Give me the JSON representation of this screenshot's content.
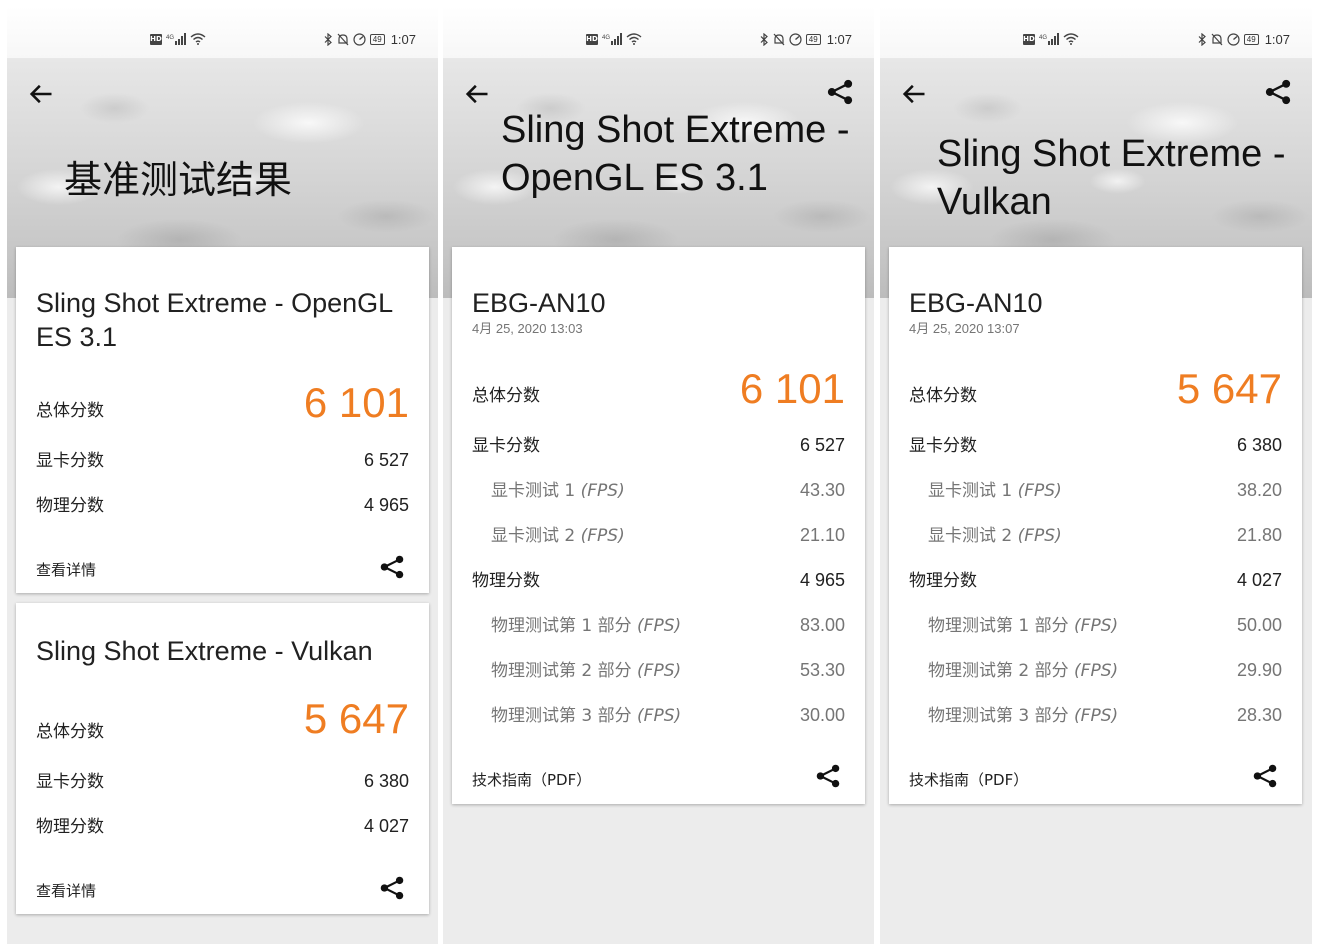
{
  "status_bar": {
    "hd": "HD",
    "network": "4G",
    "battery": "49",
    "time": "1:07"
  },
  "screens": [
    {
      "title": "基准测试结果",
      "cards": [
        {
          "title": "Sling Shot Extreme - OpenGL ES 3.1",
          "overall_label": "总体分数",
          "overall_value": "6 101",
          "graphics_label": "显卡分数",
          "graphics_value": "6 527",
          "physics_label": "物理分数",
          "physics_value": "4 965",
          "details_link": "查看详情"
        },
        {
          "title": "Sling Shot Extreme - Vulkan",
          "overall_label": "总体分数",
          "overall_value": "5 647",
          "graphics_label": "显卡分数",
          "graphics_value": "6 380",
          "physics_label": "物理分数",
          "physics_value": "4 027",
          "details_link": "查看详情"
        }
      ]
    },
    {
      "title": "Sling Shot Extreme - OpenGL ES 3.1",
      "card": {
        "device": "EBG-AN10",
        "date": "4月 25, 2020 13:03",
        "overall_label": "总体分数",
        "overall_value": "6 101",
        "graphics_label": "显卡分数",
        "graphics_value": "6 527",
        "gt1_label": "显卡测试 1",
        "gt2_label": "显卡测试 2",
        "fps_unit": "(FPS)",
        "gt1_value": "43.30",
        "gt2_value": "21.10",
        "physics_label": "物理分数",
        "physics_value": "4 965",
        "pt1_label": "物理测试第 1 部分",
        "pt2_label": "物理测试第 2 部分",
        "pt3_label": "物理测试第 3 部分",
        "pt1_value": "83.00",
        "pt2_value": "53.30",
        "pt3_value": "30.00",
        "guide_link": "技术指南（PDF）"
      }
    },
    {
      "title": "Sling Shot Extreme - Vulkan",
      "card": {
        "device": "EBG-AN10",
        "date": "4月 25, 2020 13:07",
        "overall_label": "总体分数",
        "overall_value": "5 647",
        "graphics_label": "显卡分数",
        "graphics_value": "6 380",
        "gt1_label": "显卡测试 1",
        "gt2_label": "显卡测试 2",
        "fps_unit": "(FPS)",
        "gt1_value": "38.20",
        "gt2_value": "21.80",
        "physics_label": "物理分数",
        "physics_value": "4 027",
        "pt1_label": "物理测试第 1 部分",
        "pt2_label": "物理测试第 2 部分",
        "pt3_label": "物理测试第 3 部分",
        "pt1_value": "50.00",
        "pt2_value": "29.90",
        "pt3_value": "28.30",
        "guide_link": "技术指南（PDF）"
      }
    }
  ],
  "colors": {
    "accent_orange": "#ef7d22",
    "text_primary": "#212121",
    "text_secondary": "#757575"
  },
  "icons": [
    "back-arrow-icon",
    "share-icon",
    "wifi-icon",
    "signal-icon",
    "bluetooth-icon",
    "mute-icon",
    "battery-icon"
  ]
}
